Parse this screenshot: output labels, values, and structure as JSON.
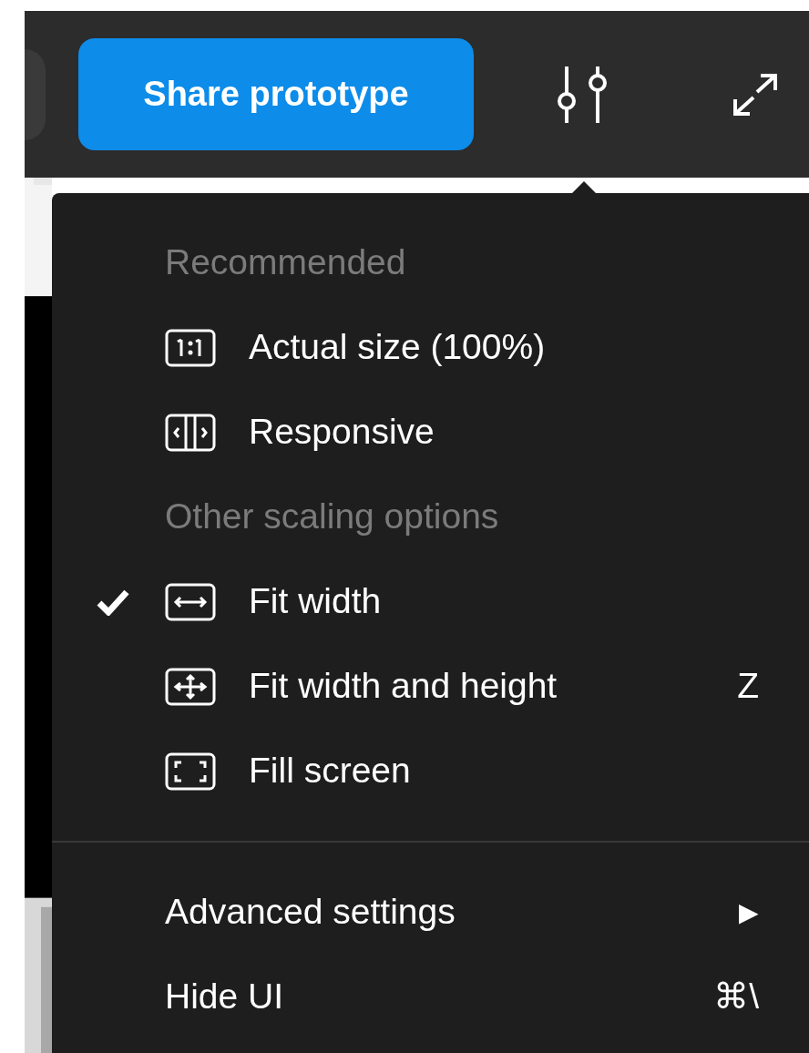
{
  "toolbar": {
    "share_button": "Share prototype"
  },
  "menu": {
    "sections": [
      {
        "heading": "Recommended",
        "items": [
          {
            "label": "Actual size (100%)",
            "checked": false
          },
          {
            "label": "Responsive",
            "checked": false
          }
        ]
      },
      {
        "heading": "Other scaling options",
        "items": [
          {
            "label": "Fit width",
            "checked": true
          },
          {
            "label": "Fit width and height",
            "checked": false,
            "shortcut": "Z"
          },
          {
            "label": "Fill screen",
            "checked": false
          }
        ]
      }
    ],
    "footer_items": [
      {
        "label": "Advanced settings",
        "submenu_arrow": "▶"
      },
      {
        "label": "Hide UI",
        "shortcut": "⌘\\"
      }
    ]
  }
}
